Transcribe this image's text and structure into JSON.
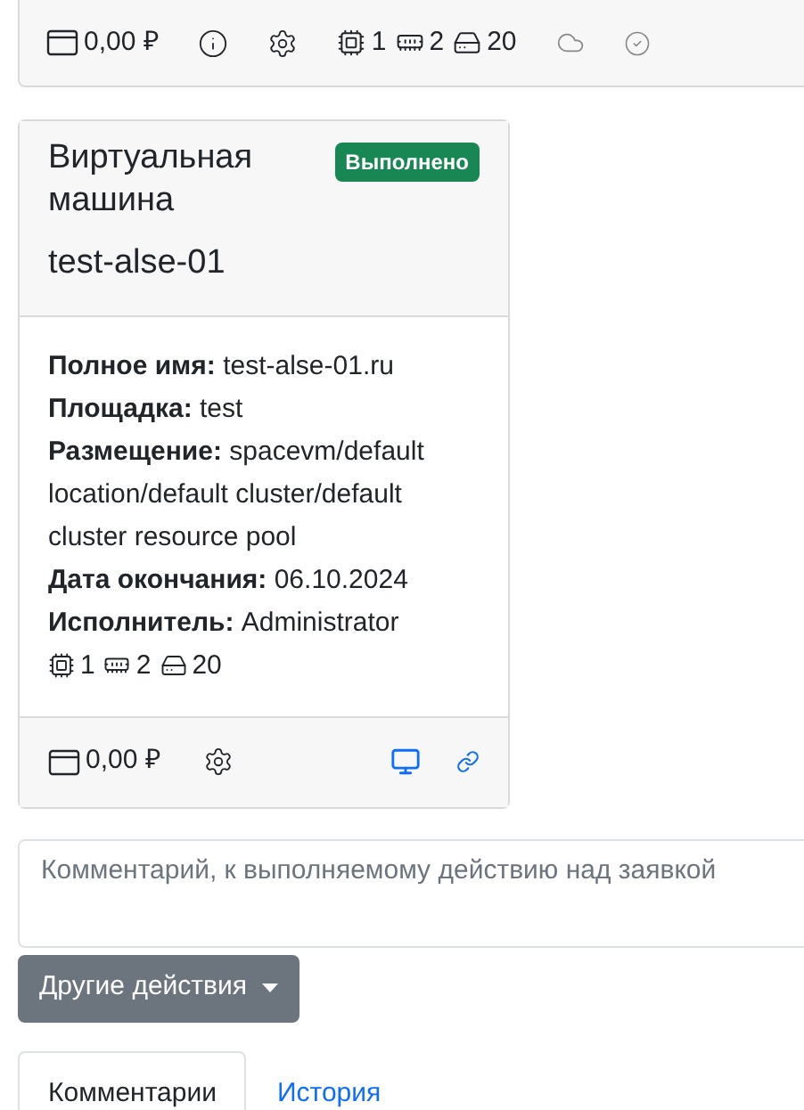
{
  "top_card": {
    "price": "0,00 ₽",
    "cpu": "1",
    "ram": "2",
    "disk": "20"
  },
  "vm_card": {
    "title": "Виртуальная машина",
    "badge": "Выполнено",
    "name": "test-alse-01",
    "fields": [
      "**Полное имя:** test-alse-01.ru",
      "**Площадка:** test",
      "**Размещение:** spacevm/default location/default cluster/default cluster resource pool",
      "**Дата окончания:** 06.10.2024",
      "**Исполнитель:** Administrator"
    ],
    "cpu": "1",
    "ram": "2",
    "disk": "20",
    "price": "0,00 ₽"
  },
  "comment": {
    "placeholder": "Комментарий, к выполняемому действию над заявкой"
  },
  "actions_button": "Другие действия",
  "tabs": [
    {
      "label": "Комментарии",
      "selected": true
    },
    {
      "label": "История",
      "selected": false
    }
  ]
}
